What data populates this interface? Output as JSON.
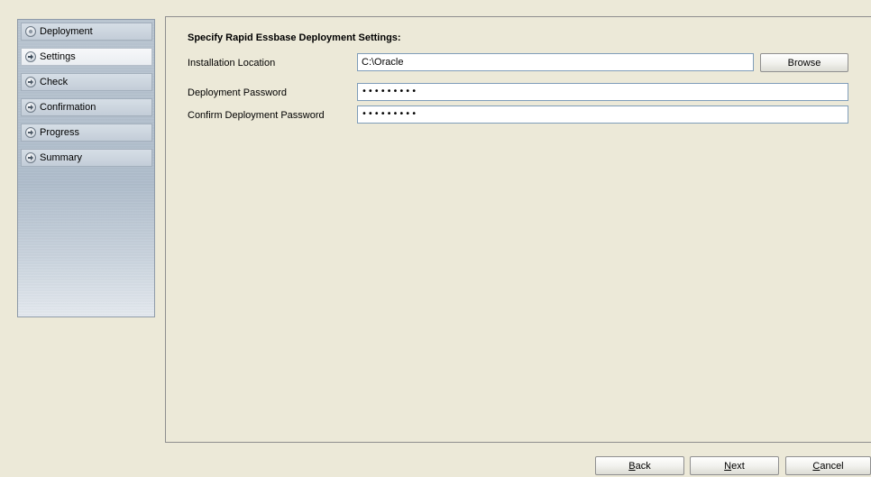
{
  "sidebar": {
    "steps": [
      {
        "label": "Deployment",
        "state": "done"
      },
      {
        "label": "Settings",
        "state": "current"
      },
      {
        "label": "Check",
        "state": "pending"
      },
      {
        "label": "Confirmation",
        "state": "pending"
      },
      {
        "label": "Progress",
        "state": "pending"
      },
      {
        "label": "Summary",
        "state": "pending"
      }
    ]
  },
  "main": {
    "title": "Specify Rapid Essbase Deployment Settings:",
    "installation_location": {
      "label": "Installation Location",
      "value": "C:\\Oracle",
      "browse_label": "Browse"
    },
    "deployment_password": {
      "label": "Deployment Password",
      "value": "•••••••••"
    },
    "confirm_password": {
      "label": "Confirm Deployment Password",
      "value": "•••••••••"
    }
  },
  "footer": {
    "back_label": "Back",
    "next_label": "Next",
    "cancel_label": "Cancel"
  },
  "colors": {
    "window_bg": "#ece9d8",
    "sidebar_bg": "#aebccb",
    "input_border": "#7f9db9"
  }
}
